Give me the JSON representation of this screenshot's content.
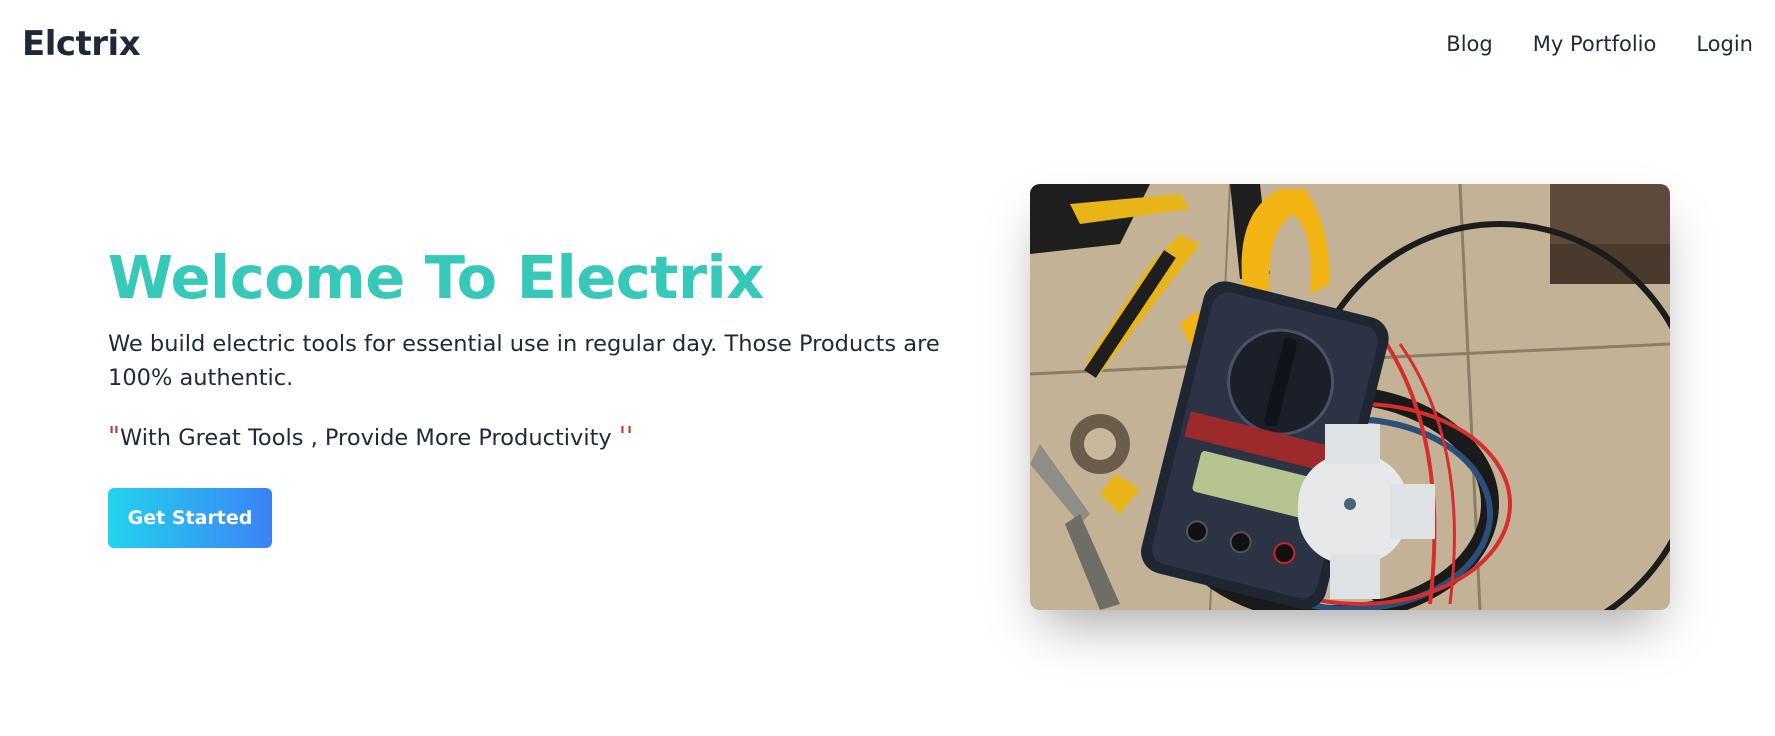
{
  "navbar": {
    "brand": "Elctrix",
    "links": [
      {
        "label": "Blog"
      },
      {
        "label": "My Portfolio"
      },
      {
        "label": "Login"
      }
    ]
  },
  "hero": {
    "title": "Welcome To Electrix",
    "description": "We build electric tools for essential use in regular day. Those Products are 100% authentic.",
    "quote_open": "\"",
    "quote_text": "With Great Tools , Provide More Productivity ",
    "quote_close": "''",
    "cta_label": "Get Started",
    "image_icon": "multimeter-tools-photo"
  },
  "colors": {
    "title": "#36c9b9",
    "quote_mark": "#c0392b",
    "button_gradient_start": "#22d3ee",
    "button_gradient_end": "#3b82f6",
    "text": "#1f2937"
  }
}
